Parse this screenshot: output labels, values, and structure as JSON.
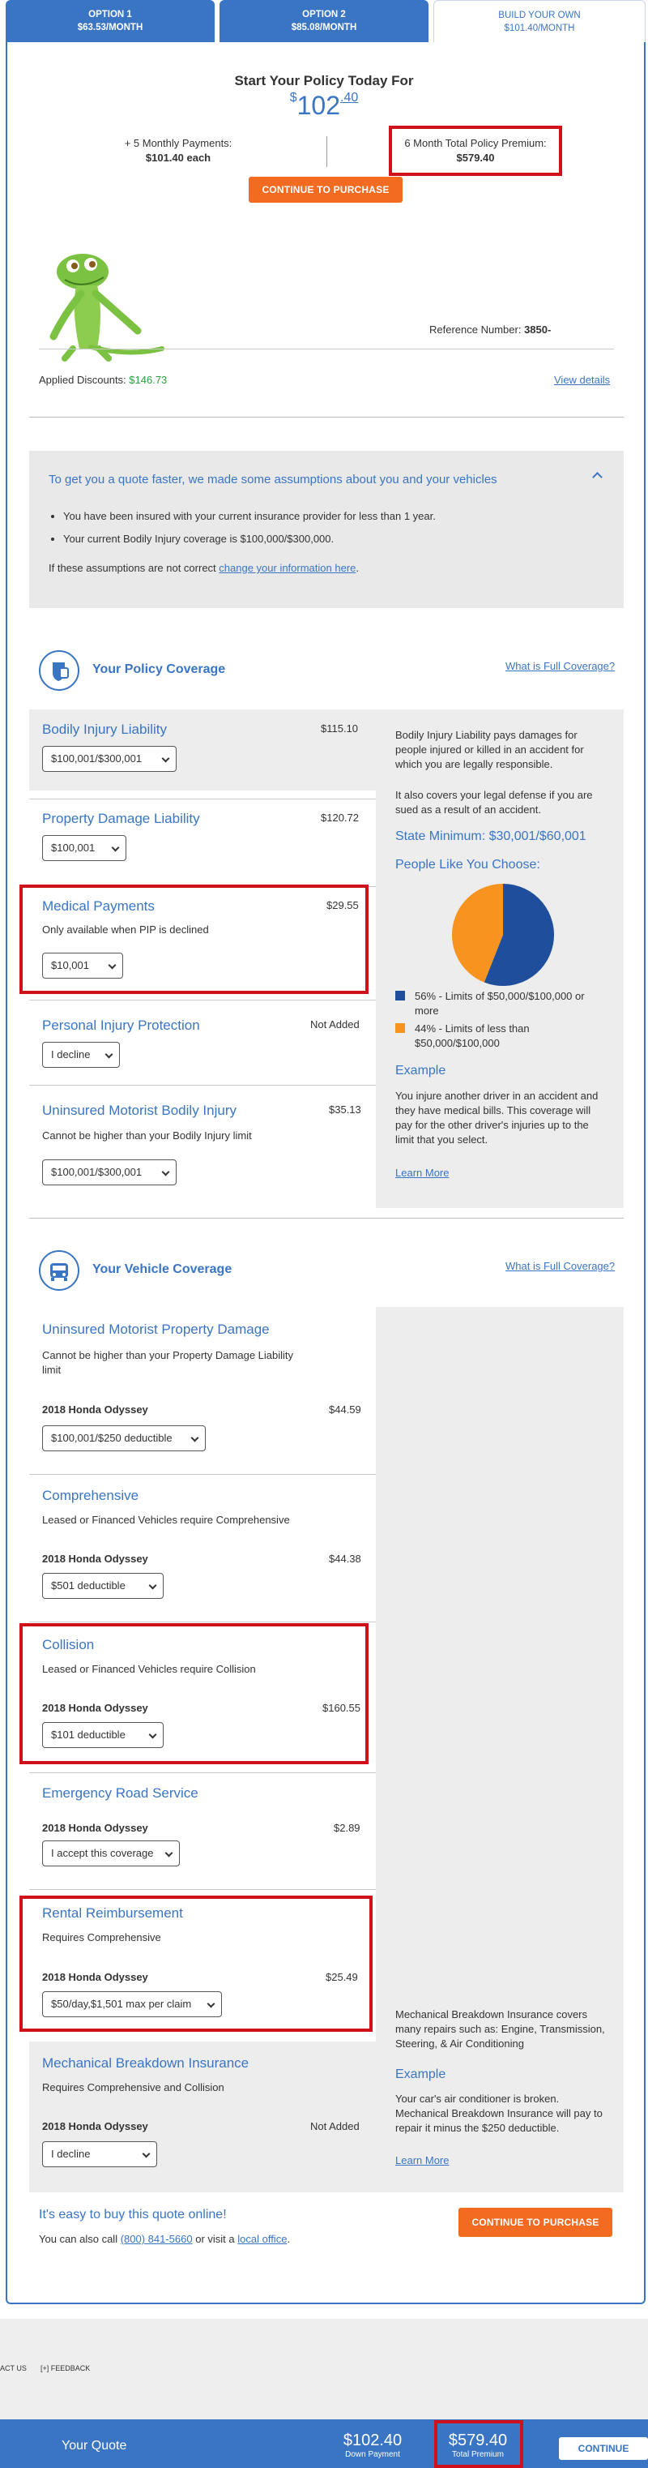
{
  "tabs": [
    {
      "title": "OPTION 1",
      "price": "$63.53/MONTH"
    },
    {
      "title": "OPTION 2",
      "price": "$85.08/MONTH"
    },
    {
      "title": "BUILD YOUR OWN",
      "price": "$101.40/MONTH"
    }
  ],
  "summary": {
    "heading": "Start Your Policy Today For",
    "price_dollar": "$",
    "price_whole": "102",
    "price_cents": ".40",
    "monthly_label": "+ 5 Monthly Payments:",
    "monthly_value": "$101.40 each",
    "total_label": "6 Month Total Policy Premium:",
    "total_value": "$579.40",
    "cta": "CONTINUE TO PURCHASE",
    "reference_label": "Reference Number:",
    "reference_value": "3850-",
    "discounts_label": "Applied Discounts:",
    "discounts_value": "$146.73",
    "view_details": "View details"
  },
  "assumptions": {
    "title": "To get you a quote faster, we made some assumptions about you and your vehicles",
    "items": [
      "You have been insured with your current insurance provider for less than 1 year.",
      "Your current Bodily Injury coverage is $100,000/$300,000."
    ],
    "footer_prefix": "If these assumptions are not correct ",
    "footer_link": "change your information here",
    "footer_suffix": "."
  },
  "policy": {
    "heading": "Your Policy Coverage",
    "full_link": "What is Full Coverage?",
    "items": [
      {
        "name": "Bodily Injury Liability",
        "price": "$115.10",
        "note": "",
        "select": "$100,001/$300,001"
      },
      {
        "name": "Property Damage Liability",
        "price": "$120.72",
        "note": "",
        "select": "$100,001"
      },
      {
        "name": "Medical Payments",
        "price": "$29.55",
        "note": "Only available when PIP is declined",
        "select": "$10,001"
      },
      {
        "name": "Personal Injury Protection",
        "price": "Not Added",
        "note": "",
        "select": "I decline"
      },
      {
        "name": "Uninsured Motorist Bodily Injury",
        "price": "$35.13",
        "note": "Cannot be higher than your Bodily Injury limit",
        "select": "$100,001/$300,001"
      }
    ],
    "side": {
      "p1": "Bodily Injury Liability pays damages for people injured or killed in an accident for which you are legally responsible.",
      "p2": "It also covers your legal defense if you are sued as a result of an accident.",
      "state_min": "State Minimum: $30,001/$60,001",
      "people": "People Like You Choose:",
      "legend": [
        {
          "text": "56% - Limits of $50,000/$100,000 or more",
          "color": "#1f4e9c",
          "value": 56
        },
        {
          "text": "44% - Limits of less than $50,000/$100,000",
          "color": "#f7931e",
          "value": 44
        }
      ],
      "example_title": "Example",
      "example": "You injure another driver in an accident and they have medical bills. This coverage will pay for the other driver's injuries up to the limit that you select.",
      "learn": "Learn More"
    }
  },
  "vehicle": {
    "heading": "Your Vehicle Coverage",
    "full_link": "What is Full Coverage?",
    "items": [
      {
        "name": "Uninsured Motorist Property Damage",
        "note": "Cannot be higher than your Property Damage Liability limit",
        "car": "2018 Honda Odyssey",
        "price": "$44.59",
        "select": "$100,001/$250 deductible"
      },
      {
        "name": "Comprehensive",
        "note": "Leased or Financed Vehicles require Comprehensive",
        "car": "2018 Honda Odyssey",
        "price": "$44.38",
        "select": "$501 deductible"
      },
      {
        "name": "Collision",
        "note": "Leased or Financed Vehicles require Collision",
        "car": "2018 Honda Odyssey",
        "price": "$160.55",
        "select": "$101 deductible"
      },
      {
        "name": "Emergency Road Service",
        "note": "",
        "car": "2018 Honda Odyssey",
        "price": "$2.89",
        "select": "I accept this coverage"
      },
      {
        "name": "Rental Reimbursement",
        "note": "Requires Comprehensive",
        "car": "2018 Honda Odyssey",
        "price": "$25.49",
        "select": "$50/day,$1,501 max per claim"
      },
      {
        "name": "Mechanical Breakdown Insurance",
        "note": "Requires Comprehensive and Collision",
        "car": "2018 Honda Odyssey",
        "price": "Not Added",
        "select": "I decline"
      }
    ],
    "side": {
      "p1": "Mechanical Breakdown Insurance covers many repairs such as: Engine, Transmission, Steering, & Air Conditioning",
      "example_title": "Example",
      "example": "Your car's air conditioner is broken. Mechanical Breakdown Insurance will pay to repair it minus the $250 deductible.",
      "learn": "Learn More"
    }
  },
  "footer_cta": {
    "easy": "It's easy to buy this quote online!",
    "call_prefix": "You can also call ",
    "phone": "(800) 841-5660",
    "call_mid": " or visit a ",
    "office": "local office",
    "call_suffix": ".",
    "button": "CONTINUE TO PURCHASE"
  },
  "page_footer": {
    "contact": "ACT US",
    "feedback": "[+] FEEDBACK"
  },
  "bottom_bar": {
    "title": "Your Quote",
    "down": "$102.40",
    "down_label": "Down Payment",
    "total": "$579.40",
    "total_label": "Total Premium",
    "button": "CONTINUE"
  }
}
